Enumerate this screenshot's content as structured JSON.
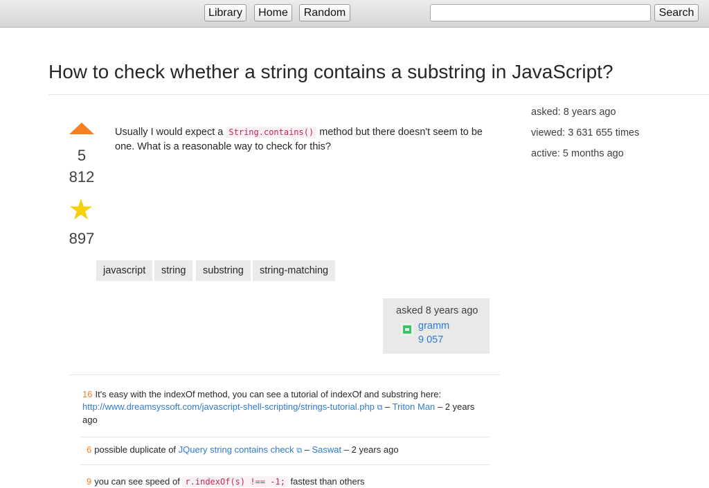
{
  "nav": {
    "library_label": "Library",
    "home_label": "Home",
    "random_label": "Random",
    "search_value": "",
    "search_button": "Search"
  },
  "question": {
    "title": "How to check whether a string contains a substring in JavaScript?",
    "body_before": "Usually I would expect a ",
    "body_code": "String.contains()",
    "body_after": " method but there doesn't seem to be one. What is a reasonable way to check for this?",
    "score_line1": "5",
    "score_line2": "812",
    "favorites": "897",
    "tags": [
      "javascript",
      "string",
      "substring",
      "string-matching"
    ],
    "asked_label": "asked 8 years ago",
    "owner_name": "gramm",
    "owner_rep": "9 057"
  },
  "sidebar": {
    "asked": "asked: 8 years ago",
    "viewed": "viewed: 3 631 655 times",
    "active": "active: 5 months ago"
  },
  "comments": [
    {
      "score": "16",
      "text": "It's easy with the indexOf method, you can see a tutorial of indexOf and substring here:",
      "link": "http://www.dreamsyssoft.com/javascript-shell-scripting/strings-tutorial.php",
      "dash": " – ",
      "author": "Triton Man",
      "time": " – 2 years ago"
    },
    {
      "score": "6",
      "text": "possible duplicate of ",
      "link": "JQuery string contains check",
      "dash": " – ",
      "author": "Saswat",
      "time": " – 2 years ago"
    },
    {
      "score": "9",
      "text": "you can see speed of ",
      "code": "r.indexOf(s) !== -1;",
      "after": " fastest than others"
    }
  ],
  "icons": {
    "vote_up": "arrow-up-icon",
    "favorite": "star-icon",
    "external": "external-link-icon",
    "avatar": "identicon-avatar"
  },
  "colors": {
    "vote_arrow": "#f48024",
    "star": "#f4d10b",
    "link": "#2e7bcf",
    "comment_score": "#f48024"
  }
}
